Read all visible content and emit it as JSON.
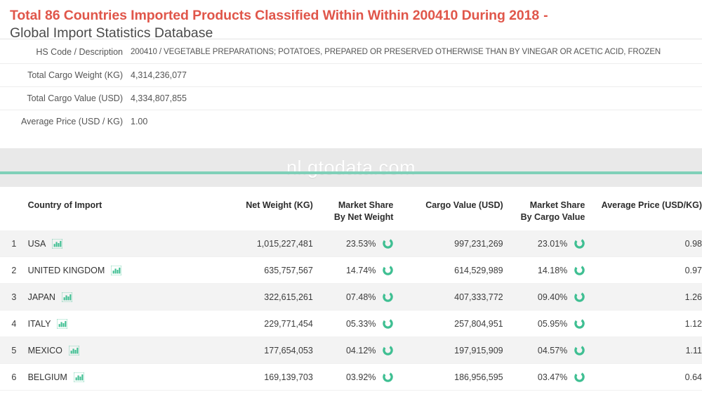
{
  "header": {
    "title_main": "Total 86 Countries Imported Products Classified Within Within 200410 During 2018",
    "title_dash": "-",
    "title_sub": "Global Import Statistics Database",
    "title_color": "#e0564a"
  },
  "summary": {
    "rows": [
      {
        "label": "HS Code / Description",
        "value": "200410 / VEGETABLE PREPARATIONS; POTATOES, PREPARED OR PRESERVED OTHERWISE THAN BY VINEGAR OR ACETIC ACID, FROZEN"
      },
      {
        "label": "Total Cargo Weight (KG)",
        "value": "4,314,236,077"
      },
      {
        "label": "Total Cargo Value (USD)",
        "value": "4,334,807,855"
      },
      {
        "label": "Average Price (USD / KG)",
        "value": "1.00"
      }
    ]
  },
  "watermark": {
    "text": "nl.gtodata.com",
    "rule_color": "#7fd0b8"
  },
  "table": {
    "headers": {
      "index": "",
      "country": "Country of Import",
      "net_weight": "Net Weight (KG)",
      "market_share_weight_l1": "Market Share",
      "market_share_weight_l2": "By Net Weight",
      "cargo_value": "Cargo Value (USD)",
      "market_share_value_l1": "Market Share",
      "market_share_value_l2": "By Cargo Value",
      "average_price": "Average Price (USD/KG)"
    },
    "header_accent_color": "#e0211c",
    "icons": {
      "bar_chart": "bar-chart-icon",
      "donut_chart": "donut-chart-icon",
      "accent": "#3fbf92"
    },
    "rows": [
      {
        "index": "1",
        "country": "USA",
        "net_weight": "1,015,227,481",
        "market_share_weight": "23.53%",
        "cargo_value": "997,231,269",
        "market_share_value": "23.01%",
        "average_price": "0.98"
      },
      {
        "index": "2",
        "country": "UNITED KINGDOM",
        "net_weight": "635,757,567",
        "market_share_weight": "14.74%",
        "cargo_value": "614,529,989",
        "market_share_value": "14.18%",
        "average_price": "0.97"
      },
      {
        "index": "3",
        "country": "JAPAN",
        "net_weight": "322,615,261",
        "market_share_weight": "07.48%",
        "cargo_value": "407,333,772",
        "market_share_value": "09.40%",
        "average_price": "1.26"
      },
      {
        "index": "4",
        "country": "ITALY",
        "net_weight": "229,771,454",
        "market_share_weight": "05.33%",
        "cargo_value": "257,804,951",
        "market_share_value": "05.95%",
        "average_price": "1.12"
      },
      {
        "index": "5",
        "country": "MEXICO",
        "net_weight": "177,654,053",
        "market_share_weight": "04.12%",
        "cargo_value": "197,915,909",
        "market_share_value": "04.57%",
        "average_price": "1.11"
      },
      {
        "index": "6",
        "country": "BELGIUM",
        "net_weight": "169,139,703",
        "market_share_weight": "03.92%",
        "cargo_value": "186,956,595",
        "market_share_value": "03.47%",
        "average_price": "0.64"
      }
    ]
  }
}
